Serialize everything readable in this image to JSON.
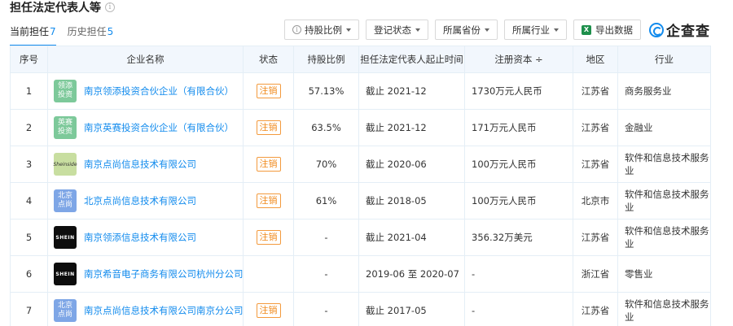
{
  "header": {
    "title": "担任法定代表人等",
    "info_icon": "i"
  },
  "tabs": [
    {
      "label": "当前担任",
      "count": "7"
    },
    {
      "label": "历史担任",
      "count": "5"
    }
  ],
  "toolbar": {
    "shareholding_ratio": "持股比例",
    "registration_status": "登记状态",
    "province": "所属省份",
    "industry": "所属行业",
    "export": "导出数据",
    "brand": "企查查"
  },
  "table": {
    "columns": [
      "序号",
      "企业名称",
      "状态",
      "持股比例",
      "担任法定代表人起止时间",
      "注册资本 ÷",
      "地区",
      "行业"
    ],
    "rows": [
      {
        "no": "1",
        "logo": "领添\n投资",
        "logo_style": "green",
        "company": "南京领添投资合伙企业（有限合伙）",
        "status": "注销",
        "ratio": "57.13%",
        "period": "截止 2021-12",
        "capital": "1730万元人民币",
        "region": "江苏省",
        "industry": "商务服务业"
      },
      {
        "no": "2",
        "logo": "英赛\n投资",
        "logo_style": "green",
        "company": "南京英赛投资合伙企业（有限合伙）",
        "status": "注销",
        "ratio": "63.5%",
        "period": "截止 2021-12",
        "capital": "171万元人民币",
        "region": "江苏省",
        "industry": "金融业"
      },
      {
        "no": "3",
        "logo": "Sheinside",
        "logo_style": "olive",
        "company": "南京点尚信息技术有限公司",
        "status": "注销",
        "ratio": "70%",
        "period": "截止 2020-06",
        "capital": "100万元人民币",
        "region": "江苏省",
        "industry": "软件和信息技术服务业"
      },
      {
        "no": "4",
        "logo": "北京\n点尚",
        "logo_style": "blue",
        "company": "北京点尚信息技术有限公司",
        "status": "注销",
        "ratio": "61%",
        "period": "截止 2018-05",
        "capital": "100万元人民币",
        "region": "北京市",
        "industry": "软件和信息技术服务业"
      },
      {
        "no": "5",
        "logo": "SHEIN",
        "logo_style": "black",
        "company": "南京领添信息技术有限公司",
        "status": "注销",
        "ratio": "-",
        "period": "截止 2021-04",
        "capital": "356.32万美元",
        "region": "江苏省",
        "industry": "软件和信息技术服务业"
      },
      {
        "no": "6",
        "logo": "SHEIN",
        "logo_style": "black",
        "company": "南京希音电子商务有限公司杭州分公司",
        "status": "",
        "ratio": "-",
        "period": "2019-06 至 2020-07",
        "capital": "-",
        "region": "浙江省",
        "industry": "零售业"
      },
      {
        "no": "7",
        "logo": "北京\n点尚",
        "logo_style": "blue",
        "company": "南京点尚信息技术有限公司南京分公司",
        "status": "注销",
        "ratio": "-",
        "period": "截止 2017-05",
        "capital": "-",
        "region": "江苏省",
        "industry": "软件和信息技术服务业"
      }
    ]
  },
  "colors": {
    "accent": "#128bed",
    "status_badge": "#f08a1d",
    "header_bg": "#f2f7fd"
  }
}
